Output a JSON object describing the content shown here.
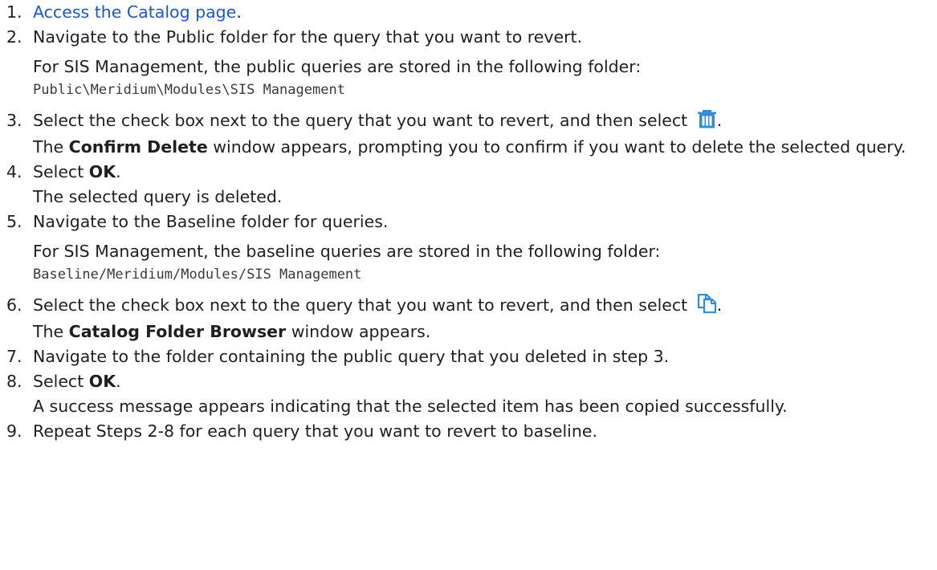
{
  "steps": [
    {
      "num": "1.",
      "link": "Access the Catalog page",
      "after_link": "."
    },
    {
      "num": "2.",
      "text": "Navigate to the Public folder for the query that you want to revert.",
      "note": "For SIS Management, the public queries are stored in the following folder:",
      "path": "Public\\Meridium\\Modules\\SIS Management"
    },
    {
      "num": "3.",
      "text_before_icon": "Select the check box next to the query that you want to revert, and then select",
      "icon": "trash-icon",
      "after_icon": ".",
      "result_bold": "Confirm Delete",
      "result_rest": " window appears, prompting you to confirm if you want to delete the selected query.",
      "result_prefix": "The "
    },
    {
      "num": "4.",
      "text_before_bold": "Select ",
      "bold": "OK",
      "after_bold": ".",
      "result": "The selected query is deleted."
    },
    {
      "num": "5.",
      "text": "Navigate to the Baseline folder for queries.",
      "note": "For SIS Management, the baseline queries are stored in the following folder:",
      "path": "Baseline/Meridium/Modules/SIS Management"
    },
    {
      "num": "6.",
      "text_before_icon": "Select the check box next to the query that you want to revert, and then select",
      "icon": "copy-icon",
      "after_icon": ".",
      "result_prefix": "The ",
      "result_bold": "Catalog Folder Browser",
      "result_rest": " window appears."
    },
    {
      "num": "7.",
      "text": "Navigate to the folder containing the public query that you deleted in step 3."
    },
    {
      "num": "8.",
      "text_before_bold": "Select ",
      "bold": "OK",
      "after_bold": ".",
      "result": "A success message appears indicating that the selected item has been copied successfully."
    },
    {
      "num": "9.",
      "text": "Repeat Steps 2-8 for each query that you want to revert to baseline."
    }
  ],
  "colors": {
    "link": "#1a56db",
    "icon": "#2e8ede",
    "text": "#1f1f1f"
  }
}
